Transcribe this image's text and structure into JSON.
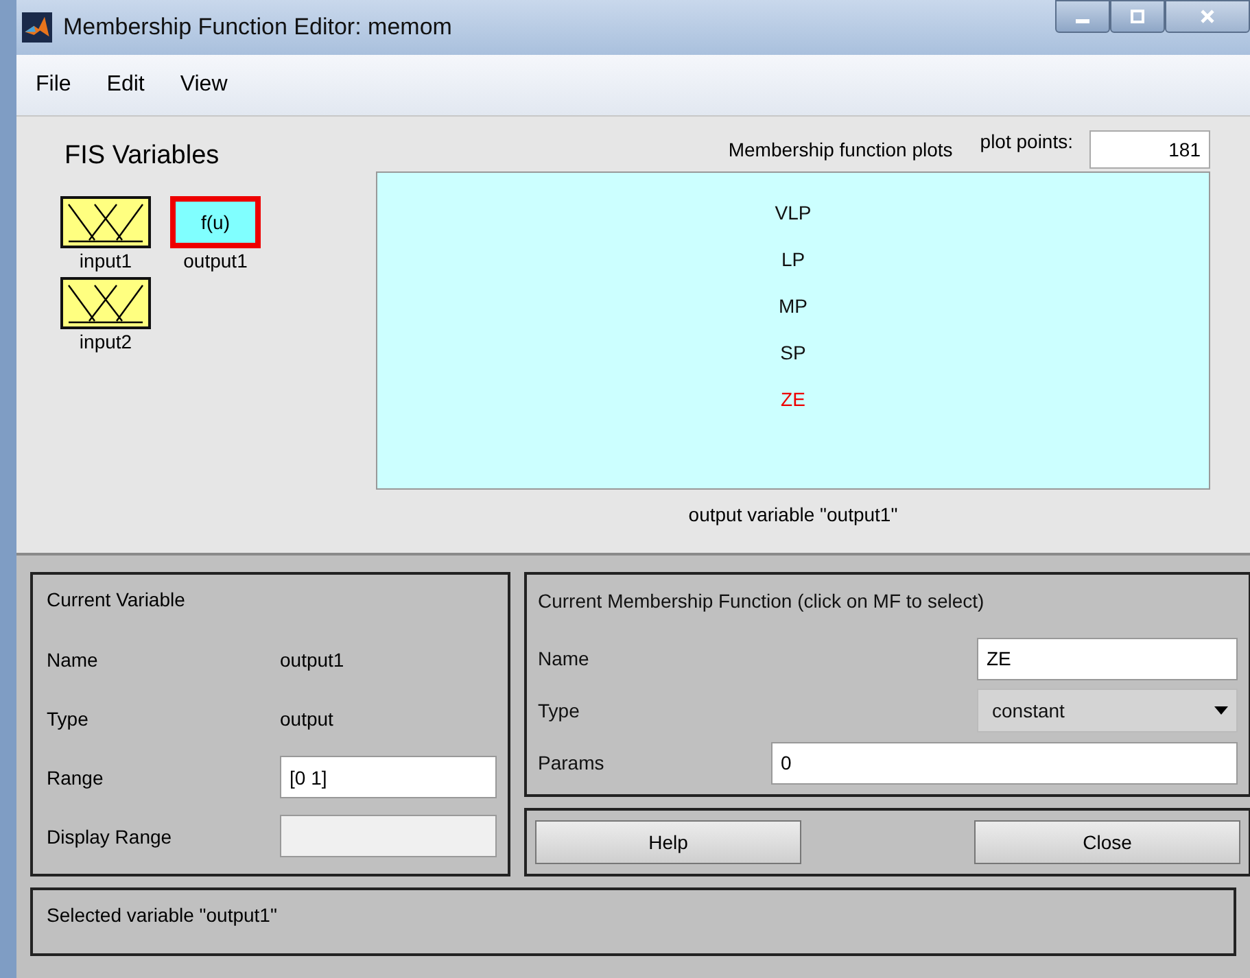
{
  "window": {
    "title": "Membership Function Editor: memom"
  },
  "menu": [
    "File",
    "Edit",
    "View"
  ],
  "fis_variables": {
    "title": "FIS Variables",
    "items": [
      {
        "label": "input1",
        "kind": "input",
        "selected": false
      },
      {
        "label": "output1",
        "kind": "output",
        "icon_text": "f(u)",
        "selected": true
      },
      {
        "label": "input2",
        "kind": "input",
        "selected": false
      }
    ]
  },
  "plot": {
    "title": "Membership function plots",
    "plot_points_label": "plot points:",
    "plot_points": "181",
    "mfs": [
      {
        "label": "VLP",
        "selected": false
      },
      {
        "label": "LP",
        "selected": false
      },
      {
        "label": "MP",
        "selected": false
      },
      {
        "label": "SP",
        "selected": false
      },
      {
        "label": "ZE",
        "selected": true
      }
    ],
    "caption": "output variable \"output1\""
  },
  "current_variable": {
    "title": "Current Variable",
    "rows": [
      {
        "label": "Name",
        "value": "output1",
        "kind": "text"
      },
      {
        "label": "Type",
        "value": "output",
        "kind": "text"
      },
      {
        "label": "Range",
        "value": "[0 1]",
        "kind": "field"
      },
      {
        "label": "Display Range",
        "kind": "disabled_field"
      }
    ]
  },
  "current_mf": {
    "title": "Current Membership Function (click on MF to select)",
    "name_label": "Name",
    "name": "ZE",
    "type_label": "Type",
    "type": "constant",
    "params_label": "Params",
    "params": "0"
  },
  "buttons": [
    "Help",
    "Close"
  ],
  "status": "Selected variable \"output1\""
}
